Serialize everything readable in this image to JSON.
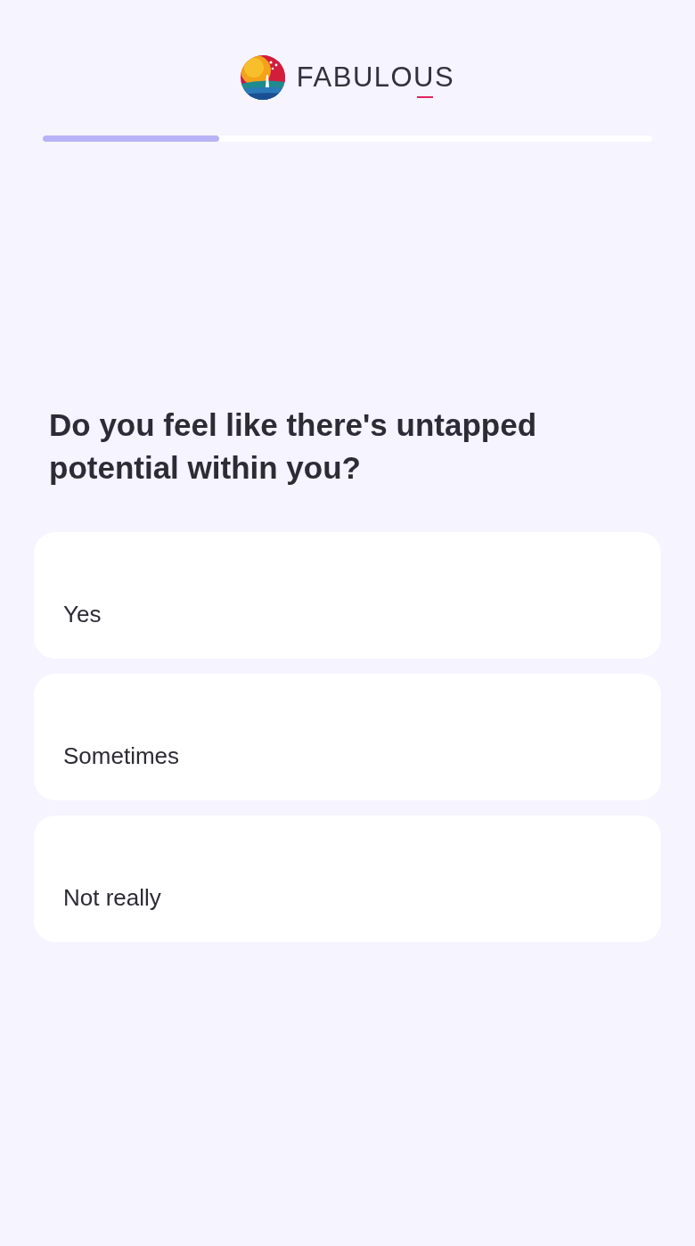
{
  "header": {
    "logo": {
      "wordmark": "FABULOUS"
    },
    "progress": {
      "level": 0.29
    }
  },
  "question": "Do you feel like there's untapped potential within you?",
  "options": [
    {
      "label": "Yes",
      "selected": false
    },
    {
      "label": "Sometimes",
      "selected": false
    },
    {
      "label": "Not really",
      "selected": false
    }
  ]
}
